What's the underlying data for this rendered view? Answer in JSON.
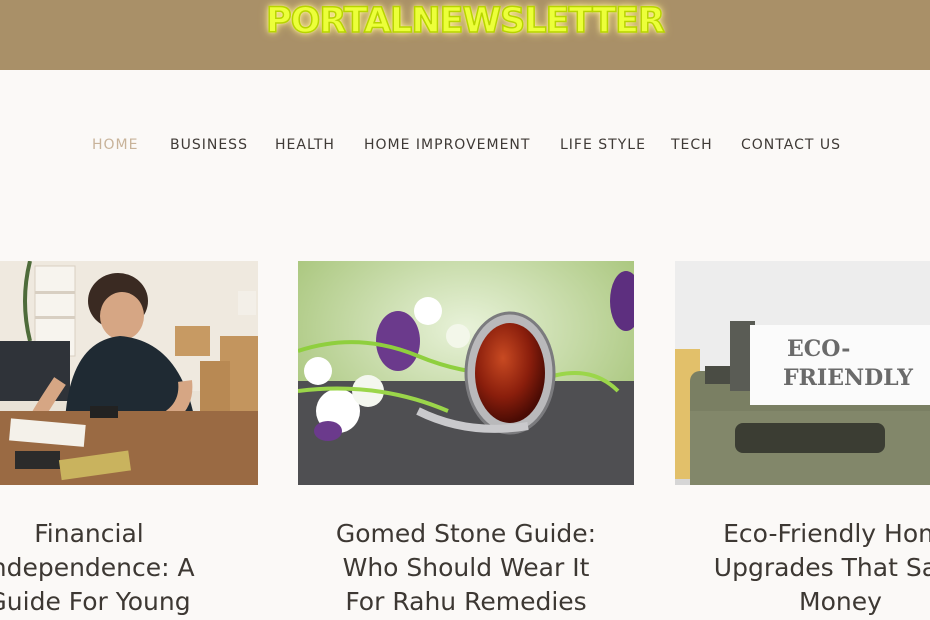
{
  "site": {
    "logo_text": "PORTALNEWSLETTER"
  },
  "nav": {
    "items": [
      {
        "label": "HOME",
        "active": true
      },
      {
        "label": "BUSINESS"
      },
      {
        "label": "HEALTH"
      },
      {
        "label": "HOME IMPROVEMENT"
      },
      {
        "label": "LIFE STYLE"
      },
      {
        "label": "TECH"
      },
      {
        "label": "CONTACT US"
      }
    ]
  },
  "posts": [
    {
      "title": "Financial\nIndependence: A\nGuide For Young"
    },
    {
      "title": "Gomed Stone Guide:\nWho Should Wear It\nFor Rahu Remedies"
    },
    {
      "title": "Eco-Friendly Home\nUpgrades That Save\nMoney",
      "image_text_1": "ECO-",
      "image_text_2": "FRIENDLY"
    }
  ],
  "colors": {
    "topbar": "#a99068",
    "logo": "#ecff3a",
    "nav_active": "#c8b39a",
    "nav_text": "#3f3a36",
    "page_bg": "#fbf9f7"
  }
}
